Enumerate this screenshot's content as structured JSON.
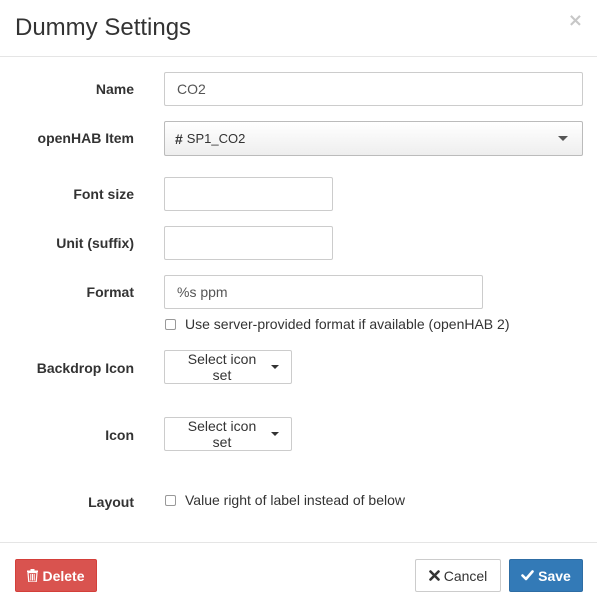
{
  "dialog": {
    "title": "Dummy Settings",
    "close_glyph": "×"
  },
  "form": {
    "name": {
      "label": "Name",
      "value": "CO2"
    },
    "item": {
      "label": "openHAB Item",
      "hash": "#",
      "value": "SP1_CO2"
    },
    "font_size": {
      "label": "Font size",
      "value": ""
    },
    "unit": {
      "label": "Unit (suffix)",
      "value": ""
    },
    "format": {
      "label": "Format",
      "value": "%s ppm",
      "server_format_label": "Use server-provided format if available (openHAB 2)",
      "server_format_checked": false
    },
    "backdrop_icon": {
      "label": "Backdrop Icon",
      "button": "Select icon set"
    },
    "icon": {
      "label": "Icon",
      "button": "Select icon set"
    },
    "layout": {
      "label": "Layout",
      "option_label": "Value right of label instead of below",
      "checked": false
    }
  },
  "footer": {
    "delete_label": "Delete",
    "cancel_label": "Cancel",
    "save_label": "Save"
  },
  "icons": {
    "close": "close-icon",
    "delete": "trash-icon",
    "cancel": "x-icon",
    "save": "checkmark-icon"
  },
  "colors": {
    "danger": "#d9534f",
    "primary": "#337ab7"
  }
}
